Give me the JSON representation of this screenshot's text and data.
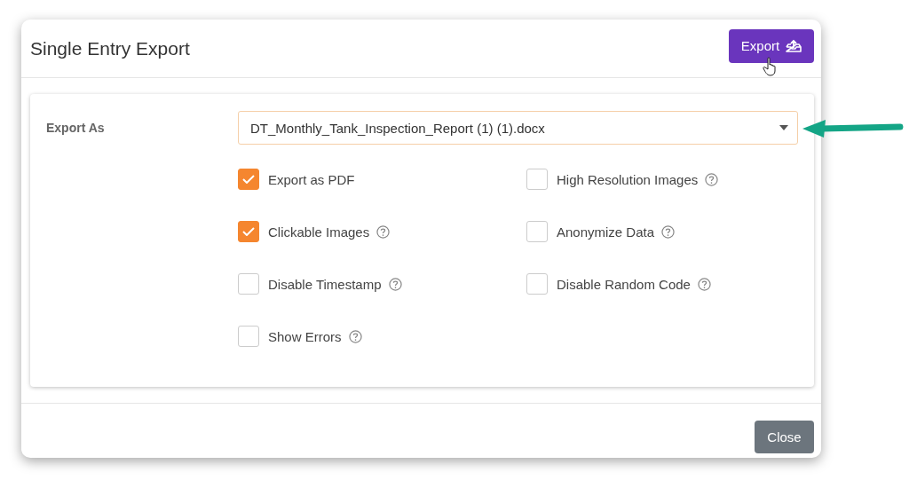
{
  "dialog": {
    "title": "Single Entry Export",
    "export_button": "Export"
  },
  "export_as": {
    "label": "Export As",
    "value": "DT_Monthly_Tank_Inspection_Report (1) (1).docx"
  },
  "options": [
    {
      "label": "Export as PDF",
      "checked": true,
      "help": false
    },
    {
      "label": "High Resolution Images",
      "checked": false,
      "help": true
    },
    {
      "label": "Clickable Images",
      "checked": true,
      "help": true
    },
    {
      "label": "Anonymize Data",
      "checked": false,
      "help": true
    },
    {
      "label": "Disable Timestamp",
      "checked": false,
      "help": true
    },
    {
      "label": "Disable Random Code",
      "checked": false,
      "help": true
    },
    {
      "label": "Show Errors",
      "checked": false,
      "help": true
    }
  ],
  "footer": {
    "close_button": "Close"
  }
}
